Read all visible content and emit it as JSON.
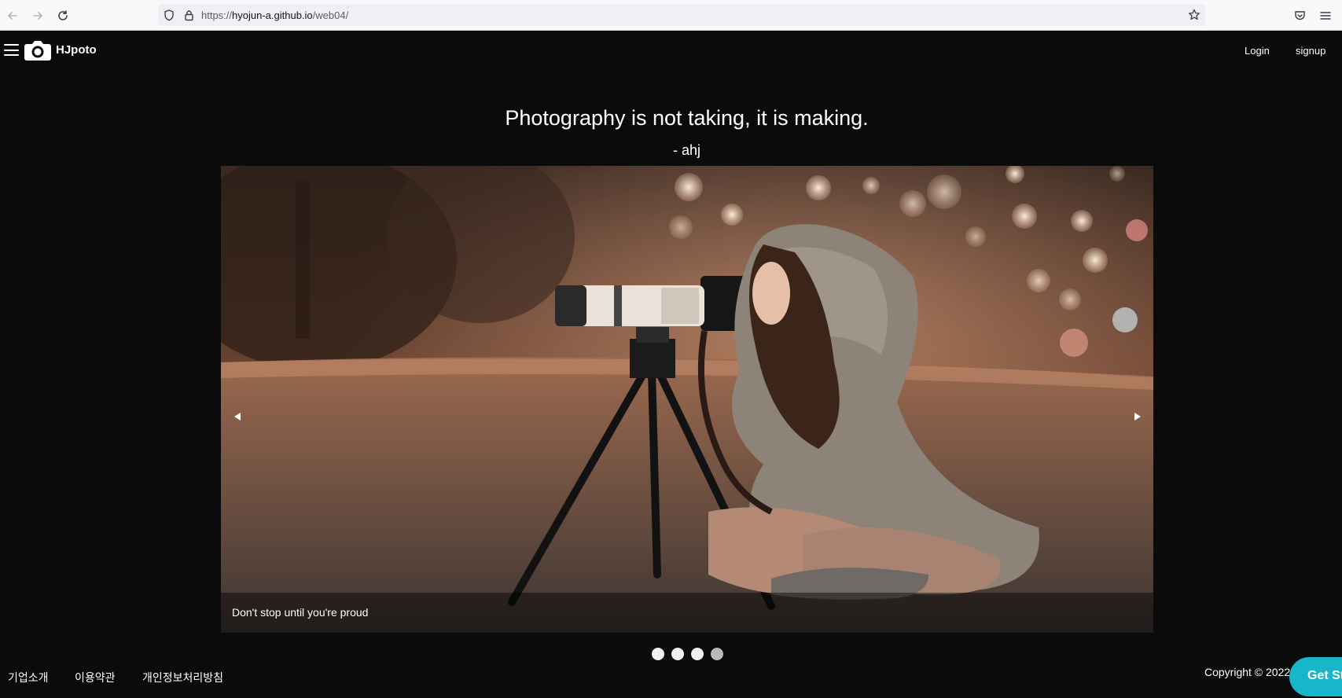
{
  "browser": {
    "url_scheme": "https://",
    "url_host": "hyojun-a.github.io",
    "url_path": "/web04/"
  },
  "header": {
    "brand": "HJpoto",
    "login_label": "Login",
    "signup_label": "signup"
  },
  "hero": {
    "quote": "Photography is not taking, it is making.",
    "author": "- ahj"
  },
  "carousel": {
    "caption": "Don't stop until you're proud",
    "slide_count": 4,
    "active_slide": 1
  },
  "footer": {
    "links": [
      "기업소개",
      "이용약관",
      "개인정보처리방침"
    ],
    "copyright": "Copyright © 2022",
    "cta_label": "Get St"
  },
  "colors": {
    "page_background": "#0b0b0c",
    "cta_accent": "#18b6c9"
  },
  "icons": [
    "back-arrow-icon",
    "forward-arrow-icon",
    "reload-icon",
    "shield-icon",
    "lock-icon",
    "bookmark-star-icon",
    "pocket-icon",
    "browser-menu-icon",
    "hamburger-menu-icon",
    "camera-icon",
    "prev-arrow-icon",
    "next-arrow-icon"
  ]
}
